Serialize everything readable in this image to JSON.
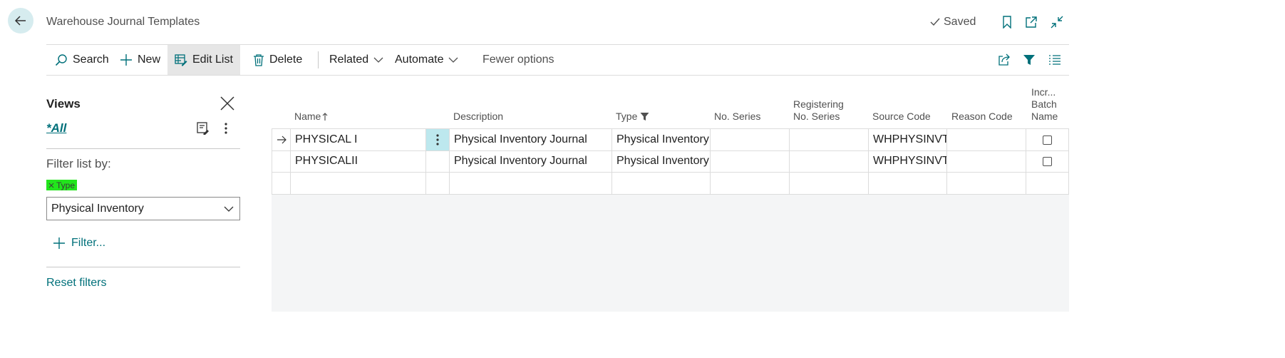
{
  "header": {
    "title": "Warehouse Journal Templates",
    "saved_label": "Saved",
    "icons": [
      "back-arrow-icon",
      "checkmark-icon",
      "bookmark-icon",
      "open-new-window-icon",
      "collapse-icon"
    ]
  },
  "actions": {
    "search": "Search",
    "new": "New",
    "edit_list": "Edit List",
    "delete": "Delete",
    "related": "Related",
    "automate": "Automate",
    "fewer_options": "Fewer options"
  },
  "views": {
    "title": "Views",
    "current_view": "*All",
    "filter_by_label": "Filter list by:",
    "type_filter_chip": "Type",
    "type_filter_value": "Physical Inventory",
    "add_filter": "Filter...",
    "reset_filters": "Reset filters"
  },
  "table": {
    "columns": {
      "name": "Name",
      "description": "Description",
      "type": "Type",
      "no_series": "No. Series",
      "registering_1": "Registering",
      "registering_2": "No. Series",
      "source_code": "Source Code",
      "reason_code": "Reason Code",
      "incr_1": "Incr...",
      "incr_2": "Batch",
      "incr_3": "Name"
    },
    "rows": [
      {
        "name": "PHYSICAL I",
        "description": "Physical Inventory Journal",
        "type": "Physical Inventory",
        "no_series": "",
        "registering_no_series": "",
        "source_code": "WHPHYSINVT",
        "reason_code": "",
        "incr_batch_name": false
      },
      {
        "name": "PHYSICALII",
        "description": "Physical Inventory Journal",
        "type": "Physical Inventory",
        "no_series": "",
        "registering_no_series": "",
        "source_code": "WHPHYSINVT",
        "reason_code": "",
        "incr_batch_name": false
      }
    ]
  },
  "colors": {
    "accent": "#00707a",
    "filter_chip": "#22e51c",
    "selected_cell": "#bde8ee",
    "back_button": "#d6ecef"
  }
}
